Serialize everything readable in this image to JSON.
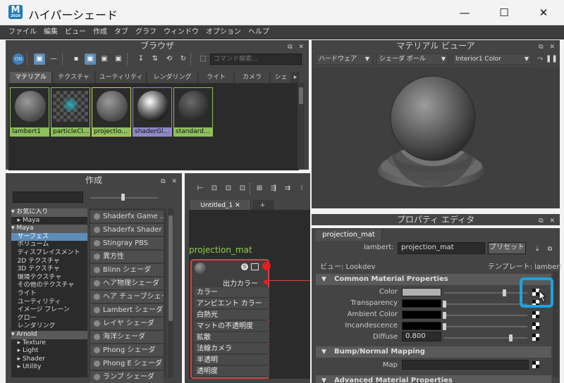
{
  "window": {
    "title": "ハイパーシェード",
    "icon_label": "M",
    "icon_sublabel": "2020",
    "min": "—",
    "max": "☐",
    "close": "✕"
  },
  "menu": [
    "ファイル",
    "編集",
    "ビュー",
    "作成",
    "タブ",
    "グラフ",
    "ウィンドウ",
    "オプション",
    "ヘルプ"
  ],
  "browser": {
    "title": "ブラウザ",
    "search_placeholder": "コマンド検索...",
    "tabs": [
      "マテリアル",
      "テクスチャ",
      "ユーティリティ",
      "レンダリング",
      "ライト",
      "カメラ",
      "シェ"
    ],
    "swatches": [
      {
        "label": "lambert1"
      },
      {
        "label": "particleCl..."
      },
      {
        "label": "projectio..."
      },
      {
        "label": "shaderGl..."
      },
      {
        "label": "standard..."
      }
    ]
  },
  "create": {
    "title": "作成",
    "tree": [
      {
        "label": "▾ お気に入り",
        "type": "grp"
      },
      {
        "label": "   ▸ Maya",
        "type": "item"
      },
      {
        "label": "▾ Maya",
        "type": "grp"
      },
      {
        "label": "   サーフェス",
        "type": "sel"
      },
      {
        "label": "   ボリューム",
        "type": "item"
      },
      {
        "label": "   ディスプレイスメント",
        "type": "item"
      },
      {
        "label": "   2D テクスチャ",
        "type": "item"
      },
      {
        "label": "   3D テクスチャ",
        "type": "item"
      },
      {
        "label": "   環境テクスチャ",
        "type": "item"
      },
      {
        "label": "   その他のテクスチャ",
        "type": "item"
      },
      {
        "label": "   ライト",
        "type": "item"
      },
      {
        "label": "   ユーティリティ",
        "type": "item"
      },
      {
        "label": "   イメージ プレーン",
        "type": "item"
      },
      {
        "label": "   グロー",
        "type": "item"
      },
      {
        "label": "   レンダリング",
        "type": "item"
      },
      {
        "label": "▾ Arnold",
        "type": "grp"
      },
      {
        "label": "   ▸ Texture",
        "type": "item"
      },
      {
        "label": "   ▸ Light",
        "type": "item"
      },
      {
        "label": "   ▸ Shader",
        "type": "item"
      },
      {
        "label": "   ▸ Utility",
        "type": "item"
      }
    ],
    "nodes": [
      "Shaderfx Game ...",
      "Shaderfx Shader",
      "Stingray PBS",
      "異方性",
      "Blinn シェーダ",
      "ヘア物理シェーダ",
      "ヘア チューブシェーダ",
      "Lambert シェーダ",
      "レイヤ シェーダ",
      "海洋シェーダ",
      "Phong シェーダ",
      "Phong E シェーダ",
      "ランプ シェーダ"
    ]
  },
  "graph": {
    "tab": "Untitled_1",
    "tab_close": "✕",
    "add_tab": "+",
    "node_title": "projection_mat",
    "out_color": "出力カラー",
    "attrs": [
      "カラー",
      "アンビエント カラー",
      "白熱光",
      "マットの不透明度",
      "拡散",
      "法線カメラ",
      "半透明",
      "透明度"
    ]
  },
  "viewer": {
    "title": "マテリアル ビューア",
    "renderer": "ハードウェア",
    "geometry": "シェーダ ボール",
    "environment": "Interior1 Color"
  },
  "props": {
    "title": "プロパティ エディタ",
    "tab": "projection_mat",
    "type_label": "lambert:",
    "name": "projection_mat",
    "preset_btn": "プリセット",
    "view_label": "ビュー: Lookdev",
    "template_label": "テンプレート: lambert",
    "sections": [
      "Common Material Properties",
      "Bump/Normal Mapping",
      "Advanced Material Properties"
    ],
    "rows": [
      {
        "label": "Color",
        "color": "#b0b0b0",
        "value": 0.72
      },
      {
        "label": "Transparency",
        "color": "#000000",
        "value": 0.0
      },
      {
        "label": "Ambient Color",
        "color": "#000000",
        "value": 0.0
      },
      {
        "label": "Incandescence",
        "color": "#000000",
        "value": 0.0
      },
      {
        "label": "Diffuse",
        "text": "0.800",
        "value": 0.8
      }
    ],
    "map_label": "Map"
  },
  "colors": {
    "accent": "#5d8db8",
    "highlight": "#1da2e0",
    "swatch_label": "#8ec05b",
    "node_border": "#d34545"
  }
}
